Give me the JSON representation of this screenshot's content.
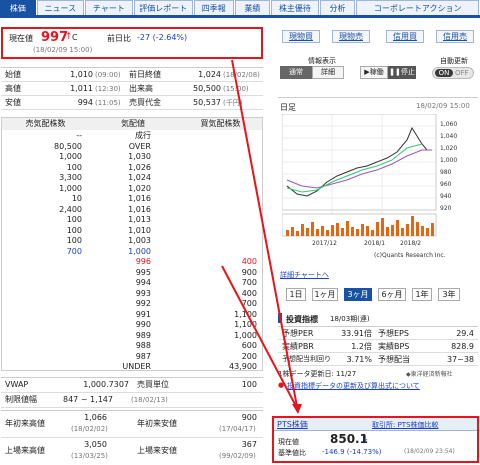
{
  "tabs": [
    "株価",
    "ニュース",
    "チャート",
    "評価レポート",
    "四季報",
    "業績",
    "株主優待",
    "分析",
    "コーポレートアクション"
  ],
  "price": {
    "label": "現在値",
    "value": "997",
    "arrow": "↑",
    "suffix": "C",
    "time": "(18/02/09 15:00)",
    "change_label": "前日比",
    "change": "-27 (-2.64%)"
  },
  "trade_buttons": [
    "現物買",
    "現物売",
    "信用買",
    "信用売"
  ],
  "display": {
    "label": "情報表示",
    "normal": "通常",
    "detail": "詳細",
    "play": "稼働",
    "stop": "停止",
    "auto_label": "自動更新",
    "on": "ON",
    "off": "OFF"
  },
  "stats": [
    {
      "l1": "始値",
      "v1": "1,010",
      "t1": "(09:00)",
      "l2": "前日終値",
      "v2": "1,024",
      "t2": "(18/02/08)"
    },
    {
      "l1": "高値",
      "v1": "1,011",
      "t1": "(12:30)",
      "l2": "出来高",
      "v2": "50,500",
      "t2": "(15:00)"
    },
    {
      "l1": "安値",
      "v1": "994",
      "t1": "(11:05)",
      "l2": "売買代金",
      "v2": "50,537",
      "t2": "(千円)"
    }
  ],
  "orderbook": {
    "headers": [
      "売気配株数",
      "気配値",
      "買気配株数"
    ],
    "rows": [
      {
        "sell": "--",
        "price": "成行",
        "buy": ""
      },
      {
        "sell": "80,500",
        "price": "OVER",
        "buy": ""
      },
      {
        "sell": "1,000",
        "price": "1,030",
        "buy": ""
      },
      {
        "sell": "100",
        "price": "1,026",
        "buy": ""
      },
      {
        "sell": "3,300",
        "price": "1,024",
        "buy": ""
      },
      {
        "sell": "1,000",
        "price": "1,020",
        "buy": ""
      },
      {
        "sell": "10",
        "price": "1,016",
        "buy": ""
      },
      {
        "sell": "2,400",
        "price": "1,016",
        "buy": ""
      },
      {
        "sell": "100",
        "price": "1,013",
        "buy": ""
      },
      {
        "sell": "100",
        "price": "1,010",
        "buy": ""
      },
      {
        "sell": "100",
        "price": "1,003",
        "buy": ""
      },
      {
        "sell": "700",
        "price": "1,000",
        "buy": ""
      },
      {
        "sell": "",
        "price": "996",
        "buy": "400"
      },
      {
        "sell": "",
        "price": "995",
        "buy": "900"
      },
      {
        "sell": "",
        "price": "994",
        "buy": "700"
      },
      {
        "sell": "",
        "price": "993",
        "buy": "400"
      },
      {
        "sell": "",
        "price": "992",
        "buy": "700"
      },
      {
        "sell": "",
        "price": "991",
        "buy": "1,100"
      },
      {
        "sell": "",
        "price": "990",
        "buy": "1,100"
      },
      {
        "sell": "",
        "price": "989",
        "buy": "1,000"
      },
      {
        "sell": "",
        "price": "988",
        "buy": "600"
      },
      {
        "sell": "",
        "price": "987",
        "buy": "200"
      },
      {
        "sell": "",
        "price": "UNDER",
        "buy": "43,900"
      }
    ]
  },
  "extra": [
    {
      "l1": "VWAP",
      "v1": "1,000.7307",
      "l2": "売買単位",
      "v2": "100"
    },
    {
      "l1": "制限値幅",
      "v1": "847 ~ 1,147",
      "t1": "(18/02/13)"
    }
  ],
  "yearly": [
    {
      "l1": "年初来高値",
      "v1": "1,066",
      "t1": "(18/02/02)",
      "l2": "年初来安値",
      "v2": "900",
      "t2": "(17/04/17)"
    },
    {
      "l1": "上場来高値",
      "v1": "3,050",
      "t1": "(13/03/25)",
      "l2": "上場来安値",
      "v2": "367",
      "t2": "(99/02/09)"
    }
  ],
  "chart": {
    "title": "日足",
    "date": "18/02/09 15:00",
    "yticks": [
      "1,060",
      "1,040",
      "1,020",
      "1,000",
      "980",
      "960",
      "940",
      "920"
    ],
    "xticks": [
      "2017/12",
      "2018/1",
      "2018/2"
    ],
    "credit": "(c)Quants Research Inc.",
    "detail_link": "詳細チャートへ"
  },
  "periods": [
    "1日",
    "1ヶ月",
    "3ヶ月",
    "6ヶ月",
    "1年",
    "3年"
  ],
  "period_active": "3ヶ月",
  "indicators": {
    "title": "投資指標",
    "sub": "18/03期(連)",
    "rows": [
      {
        "l1": "予想PER",
        "v1": "33.91倍",
        "l2": "予想EPS",
        "v2": "29.4"
      },
      {
        "l1": "実績PBR",
        "v1": "1.2倍",
        "l2": "実績BPS",
        "v2": "828.9"
      },
      {
        "l1": "予想配当利回り",
        "v1": "3.71%",
        "l2": "予想配当",
        "v2": "37~38"
      }
    ],
    "note": "1株データ更新日: 11/27",
    "note2": "◆東洋経済新報社",
    "link": "投資指標データの更新及び算出式について"
  },
  "pts": {
    "title": "PTS株価",
    "link": "取引所: PTS株価比較",
    "label": "現在値",
    "value": "850.1",
    "suffix": "↓",
    "base_label": "基準値比",
    "change": "-146.9 (-14.73%)",
    "time": "(18/02/09 23:54)"
  }
}
